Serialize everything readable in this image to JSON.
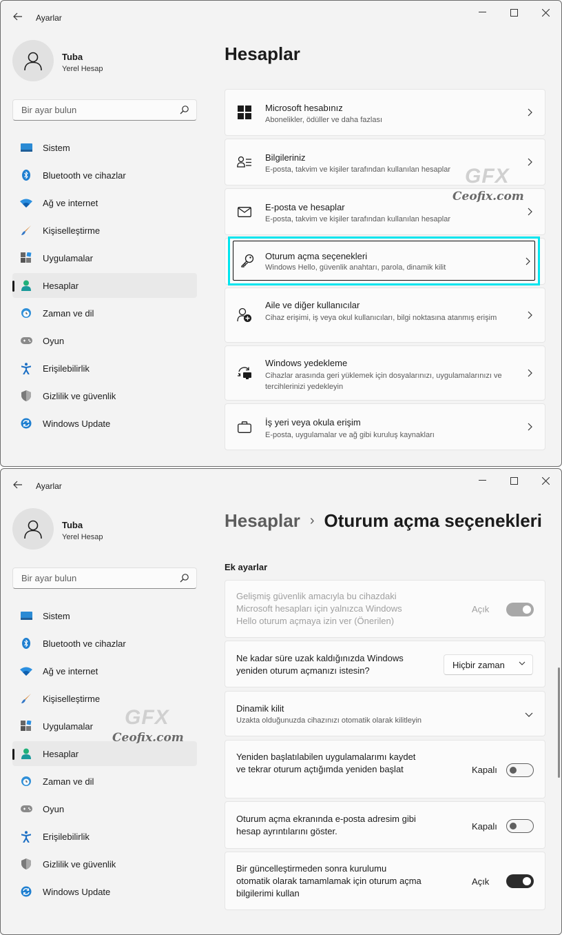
{
  "app_title": "Ayarlar",
  "user": {
    "name": "Tuba",
    "account_type": "Yerel Hesap"
  },
  "search": {
    "placeholder": "Bir ayar bulun"
  },
  "nav": [
    {
      "label": "Sistem",
      "icon": "monitor-icon"
    },
    {
      "label": "Bluetooth ve cihazlar",
      "icon": "bluetooth-icon"
    },
    {
      "label": "Ağ ve internet",
      "icon": "wifi-icon"
    },
    {
      "label": "Kişiselleştirme",
      "icon": "brush-icon"
    },
    {
      "label": "Uygulamalar",
      "icon": "apps-icon"
    },
    {
      "label": "Hesaplar",
      "icon": "person-icon",
      "selected": true
    },
    {
      "label": "Zaman ve dil",
      "icon": "clock-globe-icon"
    },
    {
      "label": "Oyun",
      "icon": "gamepad-icon"
    },
    {
      "label": "Erişilebilirlik",
      "icon": "accessibility-icon"
    },
    {
      "label": "Gizlilik ve güvenlik",
      "icon": "shield-icon"
    },
    {
      "label": "Windows Update",
      "icon": "update-icon"
    }
  ],
  "window1": {
    "page_title": "Hesaplar",
    "cards": [
      {
        "title": "Microsoft hesabınız",
        "subtitle": "Abonelikler, ödüller ve daha fazlası",
        "icon": "windows-logo-icon"
      },
      {
        "title": "Bilgileriniz",
        "subtitle": "E-posta, takvim ve kişiler tarafından kullanılan hesaplar",
        "icon": "person-card-icon"
      },
      {
        "title": "E-posta ve hesaplar",
        "subtitle": "E-posta, takvim ve kişiler tarafından kullanılan hesaplar",
        "icon": "mail-icon"
      },
      {
        "title": "Oturum açma seçenekleri",
        "subtitle": "Windows Hello, güvenlik anahtarı, parola, dinamik kilit",
        "icon": "key-icon"
      },
      {
        "title": "Aile ve diğer kullanıcılar",
        "subtitle": "Cihaz erişimi, iş veya okul kullanıcıları, bilgi noktasına atanmış erişim",
        "icon": "person-add-icon"
      },
      {
        "title": "Windows yedekleme",
        "subtitle": "Cihazlar arasında geri yüklemek için dosyalarınızı, uygulamalarınızı ve tercihlerinizi yedekleyin",
        "icon": "backup-icon"
      },
      {
        "title": "İş yeri veya okula erişim",
        "subtitle": "E-posta, uygulamalar ve ağ gibi kuruluş kaynakları",
        "icon": "briefcase-icon"
      }
    ]
  },
  "window2": {
    "breadcrumb": {
      "parent": "Hesaplar",
      "separator": "›",
      "current": "Oturum açma seçenekleri"
    },
    "section_title": "Ek ayarlar",
    "settings": [
      {
        "text": "Gelişmiş güvenlik amacıyla bu cihazdaki Microsoft hesapları için yalnızca Windows Hello oturum açmaya izin ver (Önerilen)",
        "state": "Açık",
        "toggle": "on",
        "disabled": true
      },
      {
        "text": "Ne kadar süre uzak kaldığınızda Windows yeniden oturum açmanızı istesin?",
        "dropdown_value": "Hiçbir zaman"
      },
      {
        "text": "Dinamik kilit",
        "subtitle": "Uzakta olduğunuzda cihazınızı otomatik olarak kilitleyin"
      },
      {
        "text": "Yeniden başlatılabilen uygulamalarımı kaydet ve tekrar oturum açtığımda yeniden başlat",
        "state": "Kapalı",
        "toggle": "off"
      },
      {
        "text": "Oturum açma ekranında e-posta adresim gibi hesap ayrıntılarını göster.",
        "state": "Kapalı",
        "toggle": "off"
      },
      {
        "text": "Bir güncelleştirmeden sonra kurulumu otomatik olarak tamamlamak için oturum açma bilgilerimi kullan",
        "state": "Açık",
        "toggle": "on"
      }
    ]
  },
  "watermark": {
    "logo": "GFX",
    "site": "Ceofix.com"
  },
  "colors": {
    "highlight": "#00e5ee",
    "window_bg": "#f3f3f3",
    "card_bg": "#fbfbfb",
    "accent_blue": "#0067c0"
  }
}
